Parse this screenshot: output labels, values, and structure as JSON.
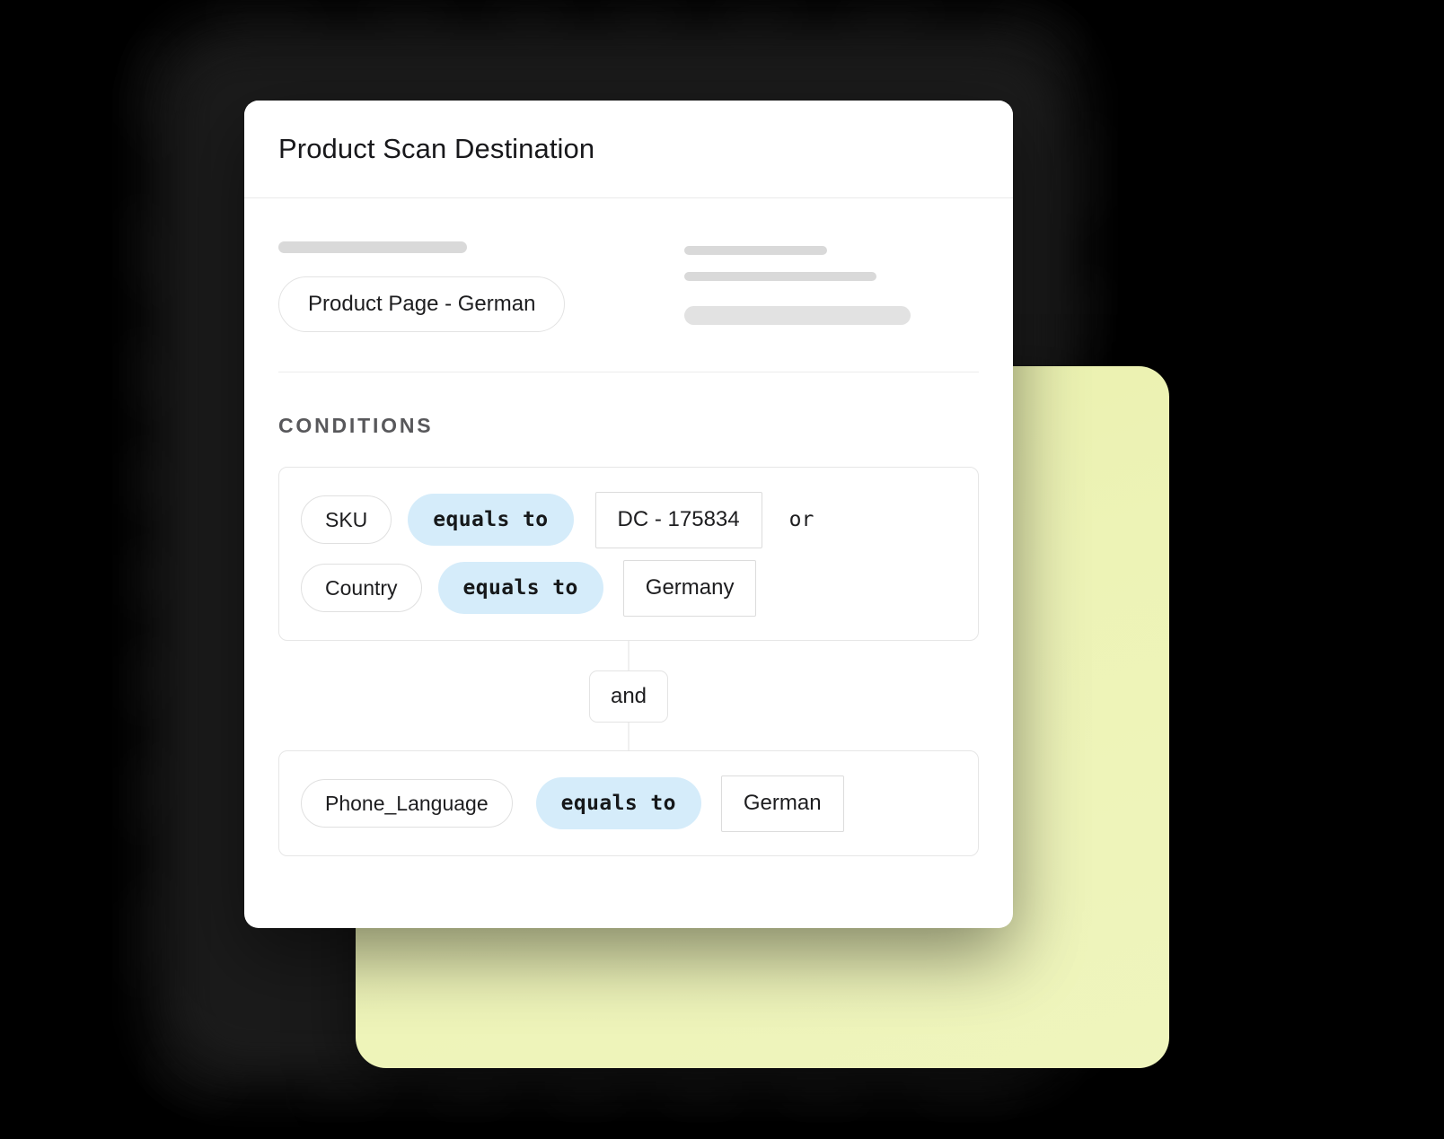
{
  "card": {
    "title": "Product Scan Destination"
  },
  "destination": {
    "value_label": "Product Page - German",
    "skeletons": {
      "left_label": "",
      "right_line_1": "",
      "right_line_2": "",
      "right_line_3": ""
    }
  },
  "conditions": {
    "heading": "CONDITIONS",
    "group_1": {
      "rows": [
        {
          "field": "SKU",
          "operator": "equals to",
          "value": "DC - 175834",
          "joiner": "or"
        },
        {
          "field": "Country",
          "operator": "equals to",
          "value": "Germany",
          "joiner": ""
        }
      ]
    },
    "connector": {
      "label": "and"
    },
    "group_2": {
      "rows": [
        {
          "field": "Phone_Language",
          "operator": "equals to",
          "value": "German",
          "joiner": ""
        }
      ]
    }
  },
  "colors": {
    "operator_pill": "#d5ecfa",
    "lime_card": "#edf3b6",
    "heading_text": "#58585b",
    "backdrop": "#000000"
  }
}
